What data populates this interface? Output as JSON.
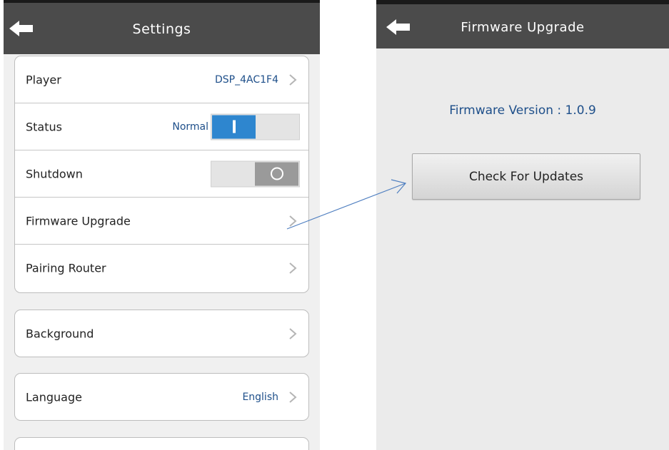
{
  "left_screen": {
    "title": "Settings",
    "group1": [
      {
        "label": "Player",
        "value": "DSP_4AC1F4"
      },
      {
        "label": "Status",
        "value": "Normal",
        "toggle": "on"
      },
      {
        "label": "Shutdown",
        "toggle": "off"
      },
      {
        "label": "Firmware Upgrade"
      },
      {
        "label": "Pairing Router"
      }
    ],
    "group2": [
      {
        "label": "Background"
      }
    ],
    "group3": [
      {
        "label": "Language",
        "value": "English"
      }
    ]
  },
  "right_screen": {
    "title": "Firmware Upgrade",
    "firmware_version": "Firmware Version : 1.0.9",
    "check_button_label": "Check For Updates"
  },
  "icons": {
    "back": "back-arrow-icon",
    "chevron": "chevron-right-icon",
    "annotation": "annotation-arrow"
  },
  "colors": {
    "titlebar": "#4b4b4b",
    "toggle_on": "#2e86cf",
    "toggle_off": "#9a9a9a",
    "value_text": "#1e4f8a",
    "annotation_arrow": "#4f7fc0"
  }
}
